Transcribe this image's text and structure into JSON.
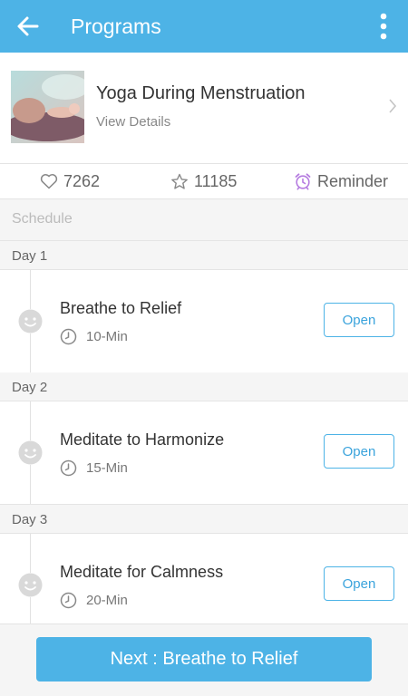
{
  "appbar": {
    "title": "Programs",
    "back_icon": "arrow-left-icon",
    "menu_icon": "more-vertical-icon"
  },
  "program": {
    "title": "Yoga During Menstruation",
    "link": "View Details"
  },
  "stats": {
    "likes": "7262",
    "stars": "11185",
    "reminder": "Reminder"
  },
  "schedule": {
    "label": "Schedule",
    "days": [
      {
        "label": "Day 1",
        "session": "Breathe to Relief",
        "duration": "10-Min",
        "button": "Open"
      },
      {
        "label": "Day 2",
        "session": "Meditate to Harmonize",
        "duration": "15-Min",
        "button": "Open"
      },
      {
        "label": "Day 3",
        "session": "Meditate for Calmness",
        "duration": "20-Min",
        "button": "Open"
      }
    ]
  },
  "footer": {
    "next_button": "Next : Breathe to Relief"
  },
  "colors": {
    "primary": "#4db3e6",
    "reminder_accent": "#b57be0"
  }
}
